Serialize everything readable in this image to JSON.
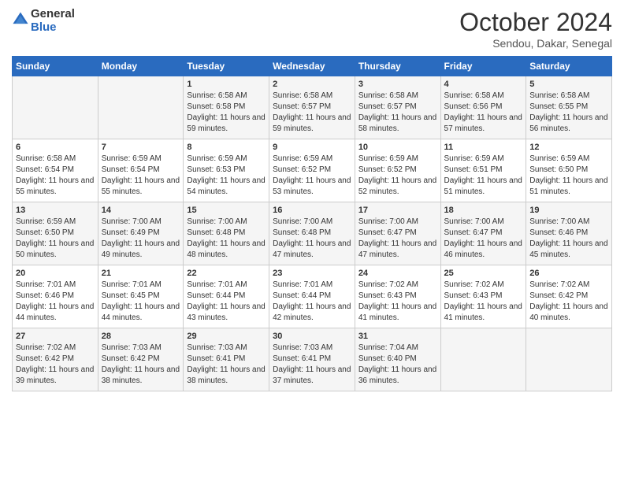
{
  "logo": {
    "general": "General",
    "blue": "Blue"
  },
  "header": {
    "month": "October 2024",
    "location": "Sendou, Dakar, Senegal"
  },
  "weekdays": [
    "Sunday",
    "Monday",
    "Tuesday",
    "Wednesday",
    "Thursday",
    "Friday",
    "Saturday"
  ],
  "weeks": [
    [
      {
        "day": "",
        "info": ""
      },
      {
        "day": "",
        "info": ""
      },
      {
        "day": "1",
        "info": "Sunrise: 6:58 AM\nSunset: 6:58 PM\nDaylight: 11 hours and 59 minutes."
      },
      {
        "day": "2",
        "info": "Sunrise: 6:58 AM\nSunset: 6:57 PM\nDaylight: 11 hours and 59 minutes."
      },
      {
        "day": "3",
        "info": "Sunrise: 6:58 AM\nSunset: 6:57 PM\nDaylight: 11 hours and 58 minutes."
      },
      {
        "day": "4",
        "info": "Sunrise: 6:58 AM\nSunset: 6:56 PM\nDaylight: 11 hours and 57 minutes."
      },
      {
        "day": "5",
        "info": "Sunrise: 6:58 AM\nSunset: 6:55 PM\nDaylight: 11 hours and 56 minutes."
      }
    ],
    [
      {
        "day": "6",
        "info": "Sunrise: 6:58 AM\nSunset: 6:54 PM\nDaylight: 11 hours and 55 minutes."
      },
      {
        "day": "7",
        "info": "Sunrise: 6:59 AM\nSunset: 6:54 PM\nDaylight: 11 hours and 55 minutes."
      },
      {
        "day": "8",
        "info": "Sunrise: 6:59 AM\nSunset: 6:53 PM\nDaylight: 11 hours and 54 minutes."
      },
      {
        "day": "9",
        "info": "Sunrise: 6:59 AM\nSunset: 6:52 PM\nDaylight: 11 hours and 53 minutes."
      },
      {
        "day": "10",
        "info": "Sunrise: 6:59 AM\nSunset: 6:52 PM\nDaylight: 11 hours and 52 minutes."
      },
      {
        "day": "11",
        "info": "Sunrise: 6:59 AM\nSunset: 6:51 PM\nDaylight: 11 hours and 51 minutes."
      },
      {
        "day": "12",
        "info": "Sunrise: 6:59 AM\nSunset: 6:50 PM\nDaylight: 11 hours and 51 minutes."
      }
    ],
    [
      {
        "day": "13",
        "info": "Sunrise: 6:59 AM\nSunset: 6:50 PM\nDaylight: 11 hours and 50 minutes."
      },
      {
        "day": "14",
        "info": "Sunrise: 7:00 AM\nSunset: 6:49 PM\nDaylight: 11 hours and 49 minutes."
      },
      {
        "day": "15",
        "info": "Sunrise: 7:00 AM\nSunset: 6:48 PM\nDaylight: 11 hours and 48 minutes."
      },
      {
        "day": "16",
        "info": "Sunrise: 7:00 AM\nSunset: 6:48 PM\nDaylight: 11 hours and 47 minutes."
      },
      {
        "day": "17",
        "info": "Sunrise: 7:00 AM\nSunset: 6:47 PM\nDaylight: 11 hours and 47 minutes."
      },
      {
        "day": "18",
        "info": "Sunrise: 7:00 AM\nSunset: 6:47 PM\nDaylight: 11 hours and 46 minutes."
      },
      {
        "day": "19",
        "info": "Sunrise: 7:00 AM\nSunset: 6:46 PM\nDaylight: 11 hours and 45 minutes."
      }
    ],
    [
      {
        "day": "20",
        "info": "Sunrise: 7:01 AM\nSunset: 6:46 PM\nDaylight: 11 hours and 44 minutes."
      },
      {
        "day": "21",
        "info": "Sunrise: 7:01 AM\nSunset: 6:45 PM\nDaylight: 11 hours and 44 minutes."
      },
      {
        "day": "22",
        "info": "Sunrise: 7:01 AM\nSunset: 6:44 PM\nDaylight: 11 hours and 43 minutes."
      },
      {
        "day": "23",
        "info": "Sunrise: 7:01 AM\nSunset: 6:44 PM\nDaylight: 11 hours and 42 minutes."
      },
      {
        "day": "24",
        "info": "Sunrise: 7:02 AM\nSunset: 6:43 PM\nDaylight: 11 hours and 41 minutes."
      },
      {
        "day": "25",
        "info": "Sunrise: 7:02 AM\nSunset: 6:43 PM\nDaylight: 11 hours and 41 minutes."
      },
      {
        "day": "26",
        "info": "Sunrise: 7:02 AM\nSunset: 6:42 PM\nDaylight: 11 hours and 40 minutes."
      }
    ],
    [
      {
        "day": "27",
        "info": "Sunrise: 7:02 AM\nSunset: 6:42 PM\nDaylight: 11 hours and 39 minutes."
      },
      {
        "day": "28",
        "info": "Sunrise: 7:03 AM\nSunset: 6:42 PM\nDaylight: 11 hours and 38 minutes."
      },
      {
        "day": "29",
        "info": "Sunrise: 7:03 AM\nSunset: 6:41 PM\nDaylight: 11 hours and 38 minutes."
      },
      {
        "day": "30",
        "info": "Sunrise: 7:03 AM\nSunset: 6:41 PM\nDaylight: 11 hours and 37 minutes."
      },
      {
        "day": "31",
        "info": "Sunrise: 7:04 AM\nSunset: 6:40 PM\nDaylight: 11 hours and 36 minutes."
      },
      {
        "day": "",
        "info": ""
      },
      {
        "day": "",
        "info": ""
      }
    ]
  ]
}
